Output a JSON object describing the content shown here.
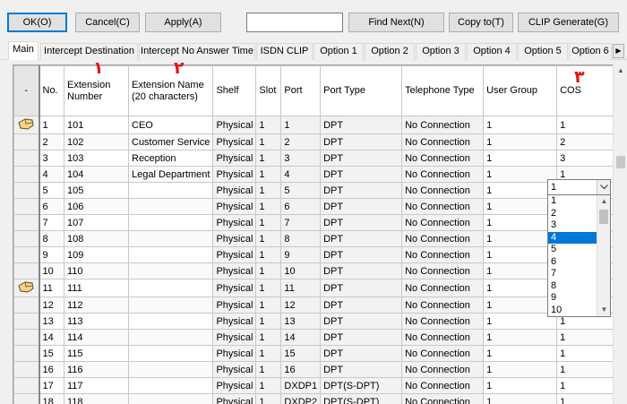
{
  "toolbar": {
    "ok_label": "OK(O)",
    "cancel_label": "Cancel(C)",
    "apply_label": "Apply(A)",
    "search_value": "",
    "find_next_label": "Find Next(N)",
    "copy_to_label": "Copy to(T)",
    "clip_generate_label": "CLIP Generate(G)"
  },
  "tabs": [
    {
      "label": "Main",
      "active": true
    },
    {
      "label": "Intercept Destination"
    },
    {
      "label": "Intercept No Answer Time"
    },
    {
      "label": "ISDN CLIP"
    },
    {
      "label": "Option 1"
    },
    {
      "label": "Option 2"
    },
    {
      "label": "Option 3"
    },
    {
      "label": "Option 4"
    },
    {
      "label": "Option 5"
    },
    {
      "label": "Option 6"
    }
  ],
  "grid": {
    "selector_header": "-",
    "columns": [
      "No.",
      "Extension Number",
      "Extension Name (20 characters)",
      "Shelf",
      "Slot",
      "Port",
      "Port Type",
      "Telephone Type",
      "User Group",
      "COS"
    ],
    "rows": [
      {
        "no": "1",
        "ext": "101",
        "name": "CEO",
        "shelf": "Physical",
        "slot": "1",
        "port": "1",
        "ptype": "DPT",
        "ttype": "No Connection",
        "group": "1",
        "cos": "1",
        "marker": true
      },
      {
        "no": "2",
        "ext": "102",
        "name": "Customer Service",
        "shelf": "Physical",
        "slot": "1",
        "port": "2",
        "ptype": "DPT",
        "ttype": "No Connection",
        "group": "1",
        "cos": "2"
      },
      {
        "no": "3",
        "ext": "103",
        "name": "Reception",
        "shelf": "Physical",
        "slot": "1",
        "port": "3",
        "ptype": "DPT",
        "ttype": "No Connection",
        "group": "1",
        "cos": "3"
      },
      {
        "no": "4",
        "ext": "104",
        "name": "Legal Department",
        "shelf": "Physical",
        "slot": "1",
        "port": "4",
        "ptype": "DPT",
        "ttype": "No Connection",
        "group": "1",
        "cos": "1"
      },
      {
        "no": "5",
        "ext": "105",
        "name": "",
        "shelf": "Physical",
        "slot": "1",
        "port": "5",
        "ptype": "DPT",
        "ttype": "No Connection",
        "group": "1",
        "cos": ""
      },
      {
        "no": "6",
        "ext": "106",
        "name": "",
        "shelf": "Physical",
        "slot": "1",
        "port": "6",
        "ptype": "DPT",
        "ttype": "No Connection",
        "group": "1",
        "cos": ""
      },
      {
        "no": "7",
        "ext": "107",
        "name": "",
        "shelf": "Physical",
        "slot": "1",
        "port": "7",
        "ptype": "DPT",
        "ttype": "No Connection",
        "group": "1",
        "cos": ""
      },
      {
        "no": "8",
        "ext": "108",
        "name": "",
        "shelf": "Physical",
        "slot": "1",
        "port": "8",
        "ptype": "DPT",
        "ttype": "No Connection",
        "group": "1",
        "cos": ""
      },
      {
        "no": "9",
        "ext": "109",
        "name": "",
        "shelf": "Physical",
        "slot": "1",
        "port": "9",
        "ptype": "DPT",
        "ttype": "No Connection",
        "group": "1",
        "cos": ""
      },
      {
        "no": "10",
        "ext": "110",
        "name": "",
        "shelf": "Physical",
        "slot": "1",
        "port": "10",
        "ptype": "DPT",
        "ttype": "No Connection",
        "group": "1",
        "cos": ""
      },
      {
        "no": "11",
        "ext": "111",
        "name": "",
        "shelf": "Physical",
        "slot": "1",
        "port": "11",
        "ptype": "DPT",
        "ttype": "No Connection",
        "group": "1",
        "cos": "",
        "marker": true
      },
      {
        "no": "12",
        "ext": "112",
        "name": "",
        "shelf": "Physical",
        "slot": "1",
        "port": "12",
        "ptype": "DPT",
        "ttype": "No Connection",
        "group": "1",
        "cos": ""
      },
      {
        "no": "13",
        "ext": "113",
        "name": "",
        "shelf": "Physical",
        "slot": "1",
        "port": "13",
        "ptype": "DPT",
        "ttype": "No Connection",
        "group": "1",
        "cos": "1"
      },
      {
        "no": "14",
        "ext": "114",
        "name": "",
        "shelf": "Physical",
        "slot": "1",
        "port": "14",
        "ptype": "DPT",
        "ttype": "No Connection",
        "group": "1",
        "cos": "1"
      },
      {
        "no": "15",
        "ext": "115",
        "name": "",
        "shelf": "Physical",
        "slot": "1",
        "port": "15",
        "ptype": "DPT",
        "ttype": "No Connection",
        "group": "1",
        "cos": "1"
      },
      {
        "no": "16",
        "ext": "116",
        "name": "",
        "shelf": "Physical",
        "slot": "1",
        "port": "16",
        "ptype": "DPT",
        "ttype": "No Connection",
        "group": "1",
        "cos": "1"
      },
      {
        "no": "17",
        "ext": "117",
        "name": "",
        "shelf": "Physical",
        "slot": "1",
        "port": "DXDP1",
        "ptype": "DPT(S-DPT)",
        "ttype": "No Connection",
        "group": "1",
        "cos": "1"
      },
      {
        "no": "18",
        "ext": "118",
        "name": "",
        "shelf": "Physical",
        "slot": "1",
        "port": "DXDP2",
        "ptype": "DPT(S-DPT)",
        "ttype": "No Connection",
        "group": "1",
        "cos": "1"
      }
    ]
  },
  "cos_dropdown": {
    "value": "1",
    "options": [
      "1",
      "2",
      "3",
      "4",
      "5",
      "6",
      "7",
      "8",
      "9",
      "10"
    ],
    "highlighted": "4"
  },
  "callouts": [
    "١",
    "٢",
    "٣"
  ],
  "colors": {
    "callout": "#e01818",
    "highlight": "#0078d7"
  }
}
